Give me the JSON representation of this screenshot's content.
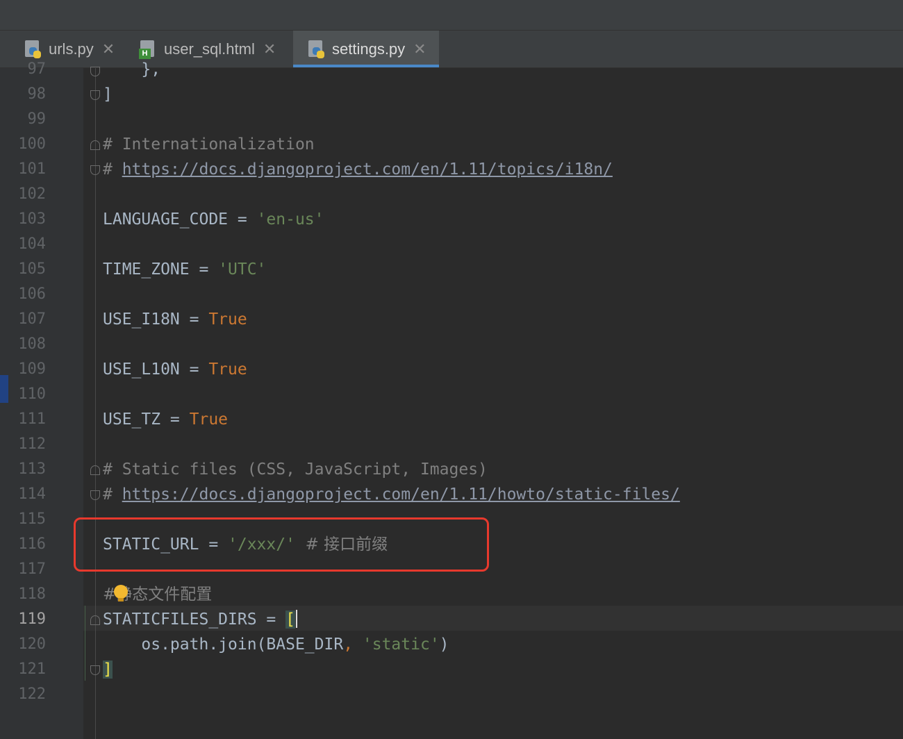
{
  "tabs": [
    {
      "label": "urls.py",
      "icon": "python-file-icon",
      "close": "✕",
      "active": false
    },
    {
      "label": "user_sql.html",
      "icon": "html-file-icon",
      "close": "✕",
      "active": false
    },
    {
      "label": "settings.py",
      "icon": "python-file-icon",
      "close": "✕",
      "active": true
    }
  ],
  "html_badge": "H",
  "line_numbers": [
    "97",
    "98",
    "99",
    "100",
    "101",
    "102",
    "103",
    "104",
    "105",
    "106",
    "107",
    "108",
    "109",
    "110",
    "111",
    "112",
    "113",
    "114",
    "115",
    "116",
    "117",
    "118",
    "119",
    "120",
    "121",
    "122"
  ],
  "current_line": "119",
  "code": {
    "l97": "    },",
    "l98": "]",
    "l100": "# Internationalization",
    "l101_hash": "# ",
    "l101_url": "https://docs.djangoproject.com/en/1.11/topics/i18n/",
    "l103_name": "LANGUAGE_CODE = ",
    "l103_val": "'en-us'",
    "l105_name": "TIME_ZONE = ",
    "l105_val": "'UTC'",
    "l107_name": "USE_I18N = ",
    "l107_val": "True",
    "l109_name": "USE_L10N = ",
    "l109_val": "True",
    "l111_name": "USE_TZ = ",
    "l111_val": "True",
    "l113": "# Static files (CSS, JavaScript, Images)",
    "l114_hash": "# ",
    "l114_url": "https://docs.djangoproject.com/en/1.11/howto/static-files/",
    "l116_name": "STATIC_URL = ",
    "l116_val": "'/xxx/'",
    "l116_comment": "  # 接口前缀",
    "l118_hash": "#",
    "l118_text": "静态文件配置",
    "l119_name": "STATICFILES_DIRS = ",
    "l119_bracket": "[",
    "l120_call": "    os.path.join(BASE_DIR",
    "l120_comma": ", ",
    "l120_str": "'static'",
    "l120_close": ")",
    "l121": "]"
  },
  "colors": {
    "background": "#2b2b2b",
    "string": "#6a8759",
    "keyword": "#cc7832",
    "comment": "#808080",
    "highlight_box": "#e8392d",
    "active_tab_underline": "#4a88c7"
  }
}
